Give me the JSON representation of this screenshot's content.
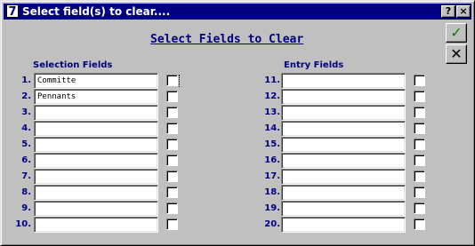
{
  "window": {
    "title": "Select field(s) to clear....",
    "icon_glyph": "7",
    "help_label": "?",
    "close_label": "×"
  },
  "heading": "Select Fields to Clear",
  "selection_header": "Selection Fields",
  "entry_header": "Entry Fields",
  "ok_glyph": "✓",
  "cancel_glyph": "✕",
  "selection_rows": [
    {
      "num": "1.",
      "value": "Committe",
      "checked": false
    },
    {
      "num": "2.",
      "value": "Pennants",
      "checked": false
    },
    {
      "num": "3.",
      "value": "",
      "checked": false
    },
    {
      "num": "4.",
      "value": "",
      "checked": false
    },
    {
      "num": "5.",
      "value": "",
      "checked": false
    },
    {
      "num": "6.",
      "value": "",
      "checked": false
    },
    {
      "num": "7.",
      "value": "",
      "checked": false
    },
    {
      "num": "8.",
      "value": "",
      "checked": false
    },
    {
      "num": "9.",
      "value": "",
      "checked": false
    },
    {
      "num": "10.",
      "value": "",
      "checked": false
    }
  ],
  "entry_rows": [
    {
      "num": "11.",
      "value": "",
      "checked": false
    },
    {
      "num": "12.",
      "value": "",
      "checked": false
    },
    {
      "num": "13.",
      "value": "",
      "checked": false
    },
    {
      "num": "14.",
      "value": "",
      "checked": false
    },
    {
      "num": "15.",
      "value": "",
      "checked": false
    },
    {
      "num": "16.",
      "value": "",
      "checked": false
    },
    {
      "num": "17.",
      "value": "",
      "checked": false
    },
    {
      "num": "18.",
      "value": "",
      "checked": false
    },
    {
      "num": "19.",
      "value": "",
      "checked": false
    },
    {
      "num": "20.",
      "value": "",
      "checked": false
    }
  ]
}
